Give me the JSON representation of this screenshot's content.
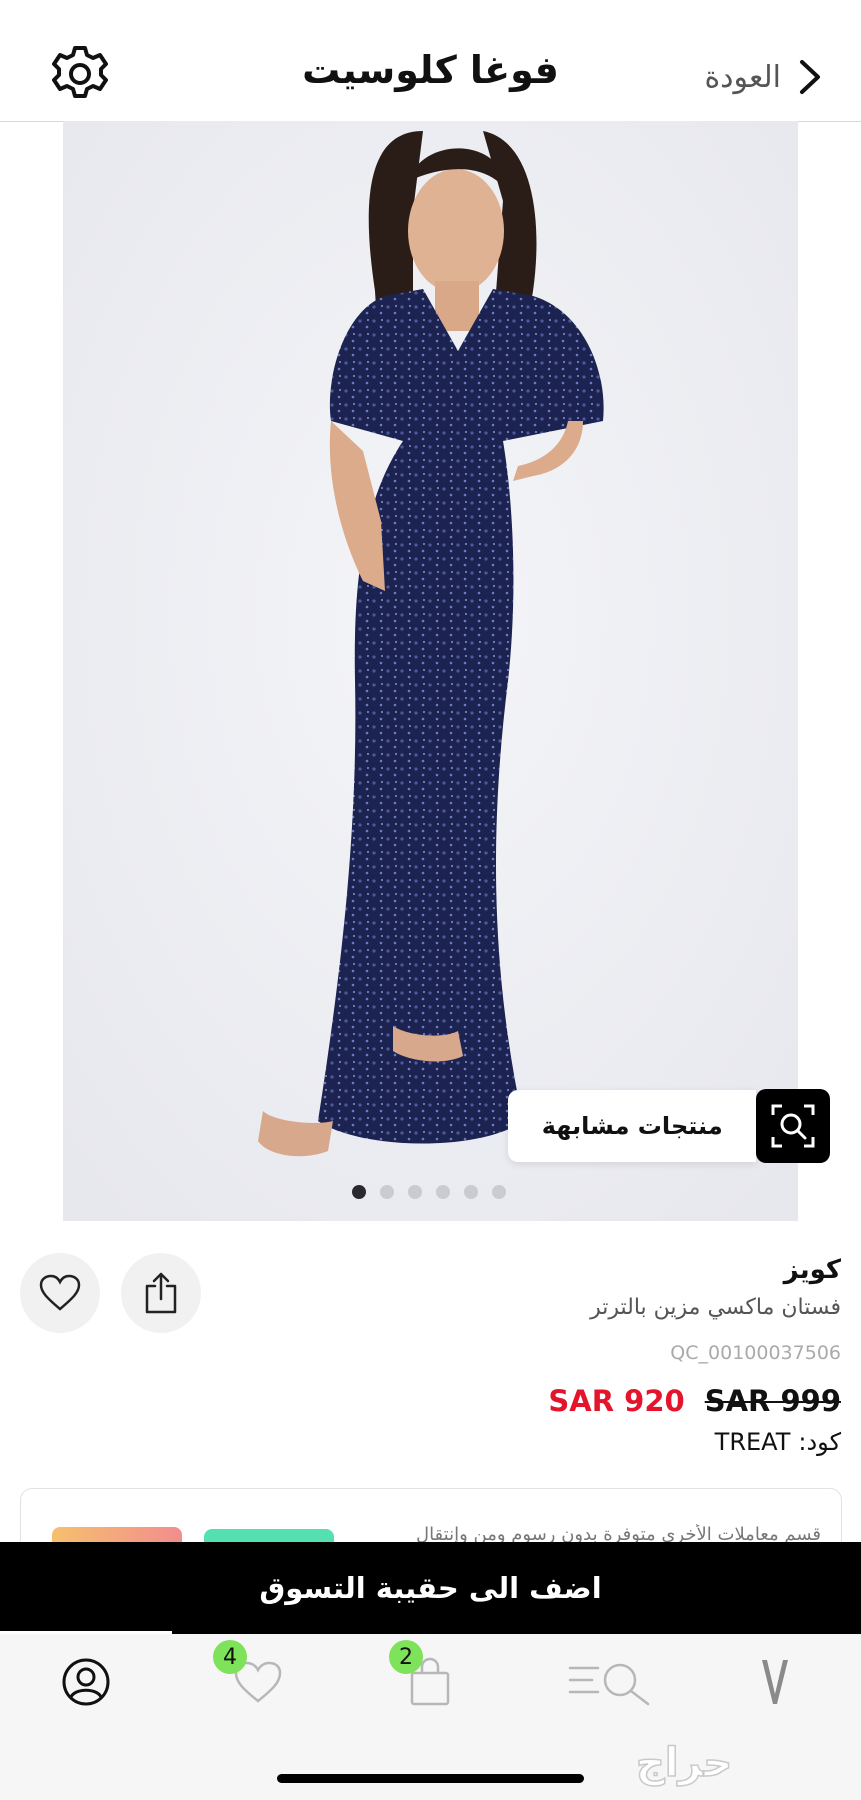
{
  "header": {
    "title": "فوغا كلوسيت",
    "back_label": "العودة"
  },
  "gallery": {
    "similar_label": "منتجات مشابهة",
    "dot_count": 6,
    "active_index": 0
  },
  "product": {
    "brand": "كويز",
    "name": "فستان ماكسي مزين بالترتر",
    "sku": "QC_00100037506",
    "price_old": "SAR 999",
    "price_new": "SAR 920",
    "code_label": "كود:",
    "code_value": "TREAT"
  },
  "promo_card": {
    "text": "قسم معاملات الأخرى متوفرة بدون رسوم ومن وإنتقال"
  },
  "cta": {
    "add_to_bag": "اضف الى حقيبة التسوق"
  },
  "bottom_nav": {
    "wishlist_count": "4",
    "bag_count": "2",
    "items": [
      "profile-icon",
      "heart-icon",
      "bag-icon",
      "search-menu-icon",
      "logo"
    ]
  },
  "watermark": "حراج",
  "colors": {
    "price_sale": "#e3142b",
    "badge": "#7ee35a",
    "cta_bg": "#000000",
    "dress": "#1c2350"
  }
}
